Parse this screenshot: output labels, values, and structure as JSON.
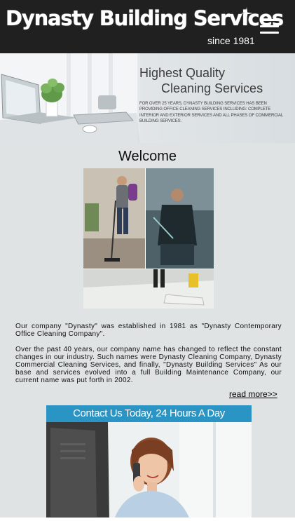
{
  "header": {
    "brand": "Dynasty Building Services",
    "tagline": "since 1981",
    "menu_icon": "hamburger-menu-icon"
  },
  "banner": {
    "headline_line1": "Highest Quality",
    "headline_line2": "Cleaning Services",
    "copy": "For over 25 years, Dynasty Building Services has been providing office cleaning services including: complete interior and exterior services and all phases of commercial building services."
  },
  "welcome": {
    "title": "Welcome",
    "paragraph1": "Our company \"Dynasty\" was established in 1981 as \"Dynasty Contemporary Office Cleaning Company\".",
    "paragraph2": "Over the past 40 years, our company name has changed to reflect the constant changes in our industry. Such names were Dynasty Cleaning Company, Dynasty Commercial Cleaning Services, and finally, \"Dynasty Building Services\" As our base and services evolved into a full Building Maintenance Company, our current name was put forth in 2002.",
    "read_more": "read more>>"
  },
  "contact": {
    "banner_text": "Contact Us Today, 24 Hours A Day"
  },
  "colors": {
    "header_bg": "#202020",
    "page_bg": "#dfe3e4",
    "contact_blue": "#2a95c4"
  }
}
